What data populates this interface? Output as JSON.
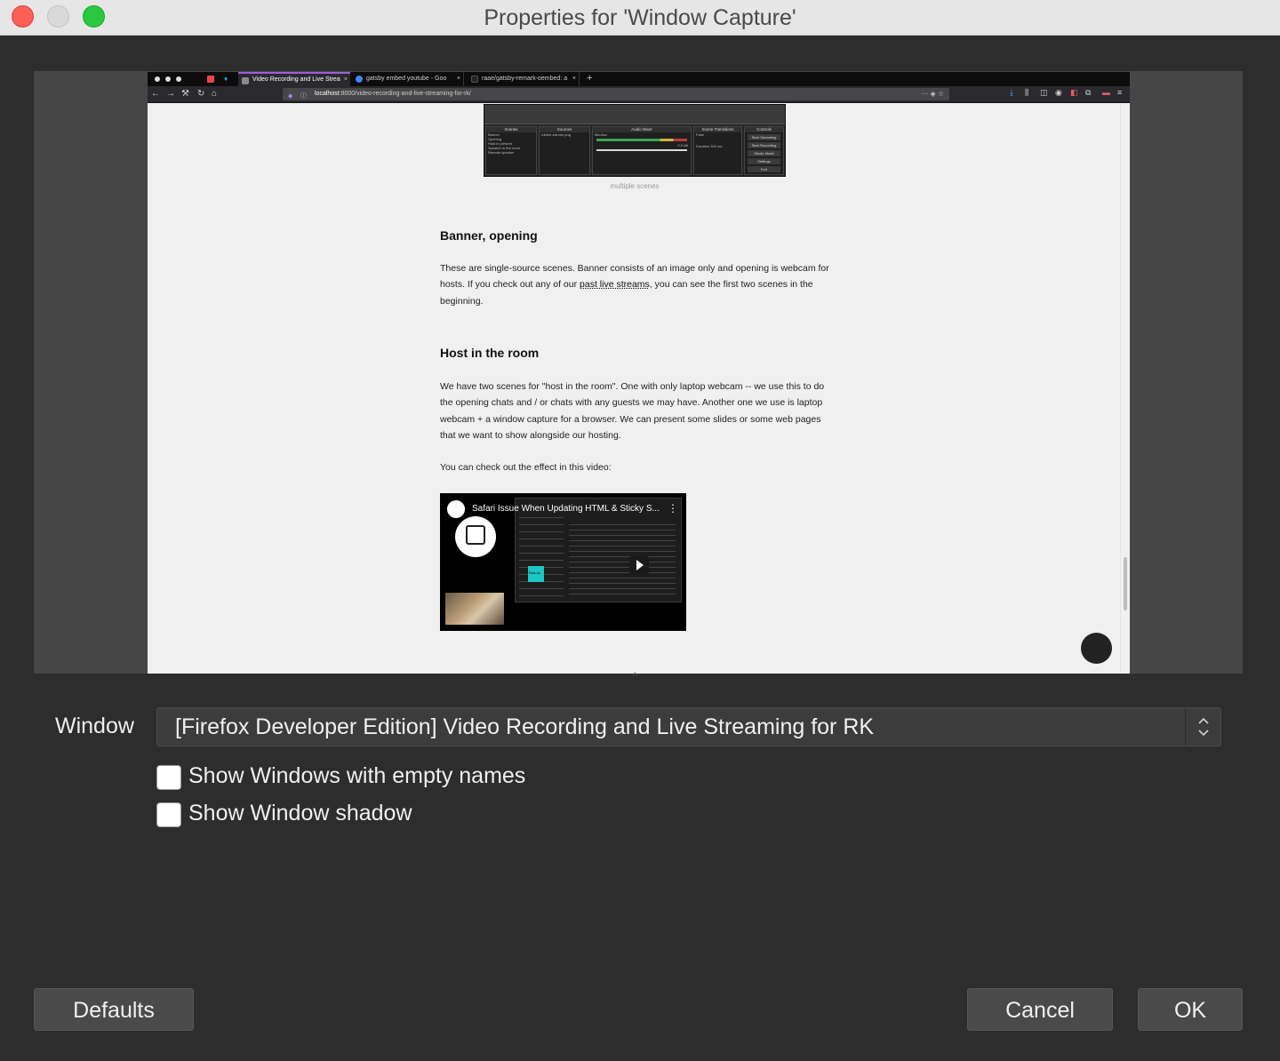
{
  "window": {
    "title": "Properties for 'Window Capture'",
    "colors": {
      "close": "#fe5f57",
      "minimize": "#d9d9d9",
      "maximize": "#28c840",
      "background": "#2d2d2d"
    }
  },
  "preview": {
    "browser": {
      "tabs": [
        {
          "label": "Video Recording and Live Strea",
          "active": true
        },
        {
          "label": "gatsby embed youtube - Goo",
          "active": false
        },
        {
          "label": "raae/gatsby-remark-oembed: a",
          "active": false
        }
      ],
      "url": {
        "host": "localhost",
        "path": ":8000/video-recording-and-live-streaming-for-rk/"
      },
      "new_tab": "+",
      "close_glyph": "×"
    },
    "embedded_obs": {
      "panels": [
        {
          "header": "Scenes",
          "lines": [
            "Banner",
            "Opening",
            "Host in present",
            "Speaker in the room",
            "Remote speaker"
          ]
        },
        {
          "header": "Sources",
          "lines": [
            "rubber-banner.png"
          ]
        },
        {
          "header": "Audio Mixer",
          "lines": [
            "Mic/Aux",
            "0.0 dB"
          ]
        },
        {
          "header": "Scene Transitions",
          "lines": [
            "Fade",
            "Duration  300 ms"
          ]
        },
        {
          "header": "Controls",
          "buttons": [
            "Start Streaming",
            "Start Recording",
            "Studio Mode",
            "Settings",
            "Exit"
          ]
        }
      ],
      "caption": "multiple scenes"
    },
    "article": {
      "section1_heading": "Banner, opening",
      "section1_para_before_link": "These are single-source scenes. Banner consists of an image only and opening is webcam for hosts. If you check out any of our ",
      "section1_link": "past live streams",
      "section1_para_after_link": ", you can see the first two scenes in the beginning.",
      "section2_heading": "Host in the room",
      "section2_para": "We have two scenes for \"host in the room\". One with only laptop webcam -- we use this to do the opening chats and / or chats with any guests we may have. Another one we use is laptop webcam + a window capture for a browser. We can present some slides or some web pages that we want to show alongside our hosting.",
      "section2_para2": "You can check out the effect in this video:",
      "video_title": "Safari Issue When Updating HTML & Sticky S...",
      "video_badge": "Rua.Lk"
    }
  },
  "form": {
    "window_label": "Window",
    "window_value": "[Firefox Developer Edition] Video Recording and Live Streaming for RK",
    "checkboxes": [
      {
        "label": "Show Windows with empty names",
        "checked": false
      },
      {
        "label": "Show Window shadow",
        "checked": false
      }
    ]
  },
  "buttons": {
    "defaults": "Defaults",
    "cancel": "Cancel",
    "ok": "OK"
  }
}
